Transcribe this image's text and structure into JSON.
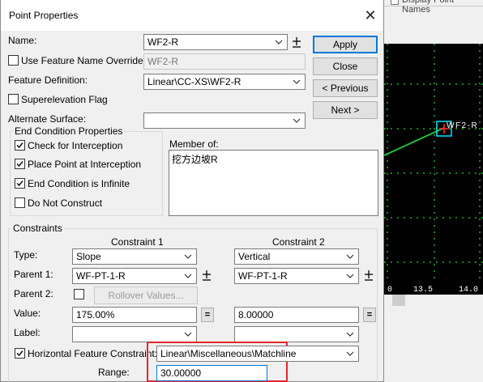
{
  "background": {
    "top_text": "Display Point Names",
    "canvas_label": "WF2-R",
    "scale_left": "0",
    "scale_mid": "13.5",
    "scale_right": "14.0",
    "colors": {
      "canvas": "#000000",
      "grid": "#3cff3c",
      "line": "#1fbf3a",
      "marker": "#00e5ff"
    }
  },
  "dialog": {
    "title": "Point Properties",
    "name_label": "Name:",
    "name_value": "WF2-R",
    "use_feature_name_override_label": "Use Feature Name Override:",
    "feature_name_override_value": "WF2-R",
    "feature_definition_label": "Feature Definition:",
    "feature_definition_value": "Linear\\CC-XS\\WF2-R",
    "superelevation_flag_label": "Superelevation Flag",
    "alternate_surface_label": "Alternate Surface:",
    "alternate_surface_value": "",
    "buttons": {
      "apply": "Apply",
      "close": "Close",
      "previous": "< Previous",
      "next": "Next >"
    },
    "end_condition": {
      "title": "End Condition Properties",
      "check_for_interception": "Check for Interception",
      "place_point_at_interception": "Place Point at Interception",
      "end_condition_is_infinite": "End Condition is Infinite",
      "do_not_construct": "Do Not Construct"
    },
    "member_of": {
      "label": "Member of:",
      "items": [
        "挖方边坡R"
      ]
    },
    "constraints": {
      "title": "Constraints",
      "constraint1_header": "Constraint 1",
      "constraint2_header": "Constraint 2",
      "type_label": "Type:",
      "type1": "Slope",
      "type2": "Vertical",
      "parent1_label": "Parent 1:",
      "parent1_c1": "WF-PT-1-R",
      "parent1_c2": "WF-PT-1-R",
      "parent2_label": "Parent 2:",
      "rollover_values": "Rollover Values...",
      "value_label": "Value:",
      "value1": "175.00%",
      "value2": "8.00000",
      "equals": "=",
      "label_label": "Label:",
      "label1": "",
      "label2": "",
      "horizontal_feature_constraint_label": "Horizontal Feature Constraint:",
      "horizontal_feature_constraint_value": "Linear\\Miscellaneous\\Matchline",
      "range_label": "Range:",
      "range_value": "30.00000"
    }
  }
}
